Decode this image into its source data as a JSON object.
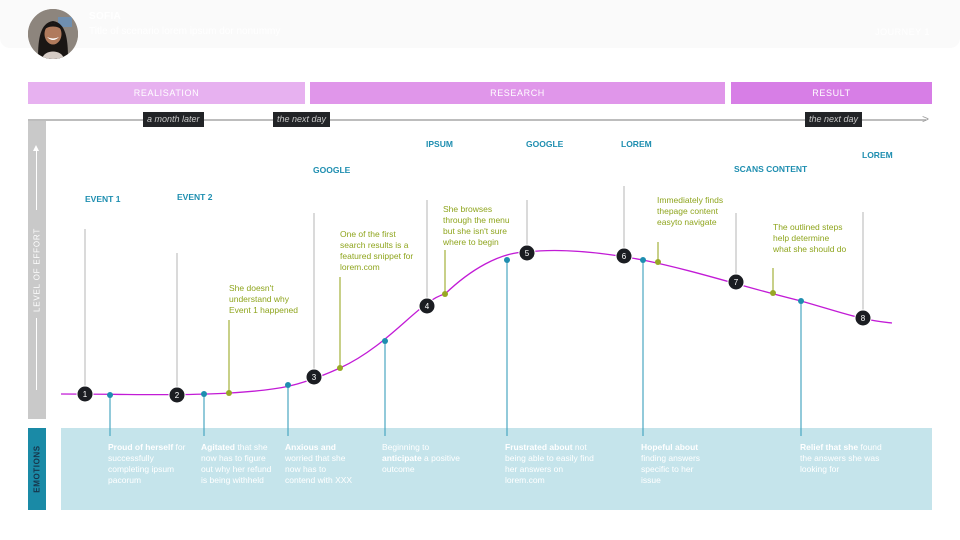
{
  "header": {
    "persona_name": "SOFIA",
    "scenario_title": "Title of scenario lorem ipsum dor nonummy",
    "journey_label": "JOURNEY 1",
    "avatar_icon": "persona-photo"
  },
  "phases": [
    {
      "label": "REALISATION",
      "color": "#e7b1f0"
    },
    {
      "label": "RESEARCH",
      "color": "#e096ea"
    },
    {
      "label": "RESULT",
      "color": "#d77ee6"
    }
  ],
  "time_tags": [
    "a month later",
    "the next day",
    "the next day"
  ],
  "axis": {
    "effort_label": "LEVEL OF EFFORT",
    "emotions_label": "EMOTIONS"
  },
  "events": [
    {
      "number": "1",
      "title": "EVENT 1"
    },
    {
      "number": "2",
      "title": "EVENT 2"
    },
    {
      "number": "3",
      "title": "GOOGLE"
    },
    {
      "number": "4",
      "title": "IPSUM"
    },
    {
      "number": "5",
      "title": "GOOGLE"
    },
    {
      "number": "6",
      "title": "LOREM"
    },
    {
      "number": "7",
      "title": "SCANS CONTENT"
    },
    {
      "number": "8",
      "title": "LOREM"
    }
  ],
  "thoughts": [
    "She doesn't understand why Event 1 happened",
    "One of the first search results is a featured snippet for lorem.com",
    "She browses through the menu but she isn't sure where to begin",
    "Immediately finds thepage content easyto navigate",
    "The outlined steps help determine what she should do"
  ],
  "emotions": [
    {
      "bold": "Proud of herself",
      "text": " for successfully completing ipsum pacorum"
    },
    {
      "bold": "Agitated",
      "text": " that she now has to figure out why her refund is being withheld"
    },
    {
      "bold": "Anxious and",
      "text": " worried that she now has to contend with XXX"
    },
    {
      "pre": "Beginning to ",
      "bold": "anticipate",
      "text": " a positive outcome"
    },
    {
      "bold": "Frustrated about",
      "text": " not being able to easily find her answers on lorem.com"
    },
    {
      "bold": "Hopeful about",
      "text": " finding answers specific to her issue"
    },
    {
      "bold": "Relief that she",
      "text": " found the answers she was looking for"
    }
  ],
  "colors": {
    "curve": "#c21bd6",
    "event_title": "#1e8eb0",
    "thought": "#8fa51e",
    "emotion_marker": "#1e8eb0",
    "step_circle": "#1b1d22"
  }
}
